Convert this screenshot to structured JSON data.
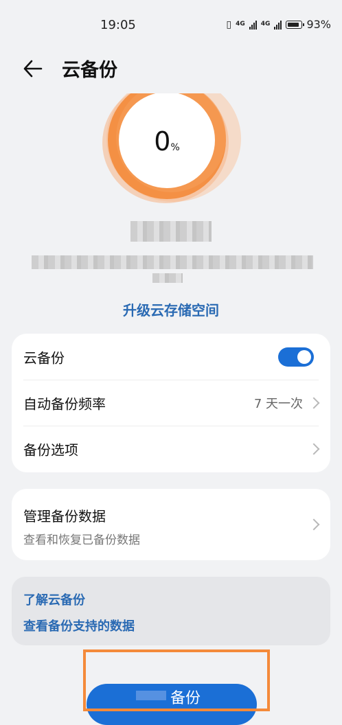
{
  "status_bar": {
    "time": "19:05",
    "net1": "4G",
    "net2": "4G",
    "battery": "93%"
  },
  "header": {
    "title": "云备份"
  },
  "progress": {
    "value": "0",
    "unit": "%"
  },
  "upgrade_link": "升级云存储空间",
  "settings": {
    "cloud_backup": {
      "label": "云备份",
      "enabled": true
    },
    "frequency": {
      "label": "自动备份频率",
      "value": "7 天一次"
    },
    "options": {
      "label": "备份选项"
    }
  },
  "manage": {
    "title": "管理备份数据",
    "subtitle": "查看和恢复已备份数据"
  },
  "info_links": {
    "learn": "了解云备份",
    "supported": "查看备份支持的数据"
  },
  "backup_button": {
    "label": "备份"
  },
  "colors": {
    "accent": "#1b6fd6",
    "link": "#2a6ab3",
    "ring": "#f48a3a",
    "highlight": "#f48a3a"
  }
}
